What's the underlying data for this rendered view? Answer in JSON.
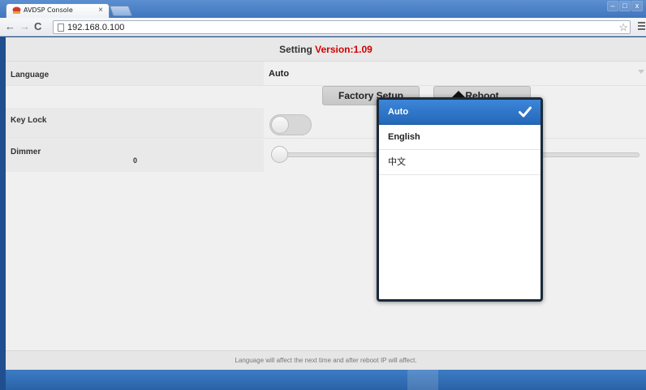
{
  "browser": {
    "tab_title": "AVDSP Console",
    "tab_close": "×",
    "url": "192.168.0.100",
    "window_controls": [
      "–",
      "□",
      "x"
    ]
  },
  "page": {
    "header": {
      "title": "Setting",
      "version": "Version:1.09"
    },
    "language": {
      "label": "Language",
      "value": "Auto"
    },
    "buttons": {
      "factory_setup": "Factory Setup",
      "reboot": "Reboot"
    },
    "key_lock": {
      "label": "Key Lock",
      "on": false
    },
    "dimmer": {
      "label": "Dimmer",
      "value": "0",
      "level": 0
    },
    "footer_note": "Language will affect the next time and after reboot IP will affect."
  },
  "dropdown": {
    "options": [
      {
        "label": "Auto",
        "selected": true
      },
      {
        "label": "English",
        "selected": false
      },
      {
        "label": "中文",
        "selected": false
      }
    ]
  },
  "colors": {
    "accent": "#2a6bba",
    "version_red": "#d00000",
    "popup_border": "#1b2a3b"
  }
}
